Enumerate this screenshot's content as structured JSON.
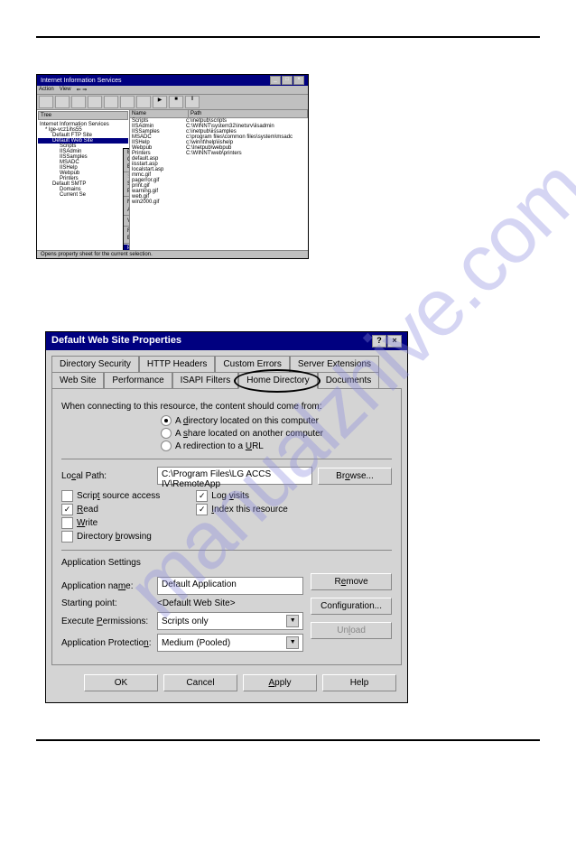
{
  "watermark": "manualzhive.com",
  "iis": {
    "title": "Internet Information Services",
    "menu": [
      "Action",
      "View"
    ],
    "tree_header": "Tree",
    "tree": [
      {
        "label": "Internet Information Services",
        "indent": 0
      },
      {
        "label": "* lge-vcz1ihs55",
        "indent": 1
      },
      {
        "label": "Default FTP Site",
        "indent": 2
      },
      {
        "label": "Default Web Site",
        "indent": 2,
        "sel": true
      },
      {
        "label": "Scripts",
        "indent": 3
      },
      {
        "label": "IISAdmin",
        "indent": 3
      },
      {
        "label": "IISSamples",
        "indent": 3
      },
      {
        "label": "MSADC",
        "indent": 3
      },
      {
        "label": "IISHelp",
        "indent": 3
      },
      {
        "label": "Webpub",
        "indent": 3
      },
      {
        "label": "Printers",
        "indent": 3
      },
      {
        "label": "Default SMTP",
        "indent": 2
      },
      {
        "label": "Domains",
        "indent": 3
      },
      {
        "label": "Current Se",
        "indent": 3
      }
    ],
    "list_headers": [
      "Name",
      "Path"
    ],
    "list": [
      {
        "name": "Scripts",
        "path": "c:\\inetpub\\scripts"
      },
      {
        "name": "IISAdmin",
        "path": "C:\\WINNT\\system32\\inetsrv\\iisadmin"
      },
      {
        "name": "IISSamples",
        "path": "c:\\inetpub\\iissamples"
      },
      {
        "name": "MSADC",
        "path": "c:\\program files\\common files\\system\\msadc"
      },
      {
        "name": "IISHelp",
        "path": "c:\\winnt\\help\\iishelp"
      },
      {
        "name": "Webpub",
        "path": "C:\\Inetpub\\webpub"
      },
      {
        "name": "Printers",
        "path": "C:\\WINNT\\web\\printers"
      },
      {
        "name": "default.asp",
        "path": ""
      },
      {
        "name": "iisstart.asp",
        "path": ""
      },
      {
        "name": "localstart.asp",
        "path": ""
      },
      {
        "name": "mmc.gif",
        "path": ""
      },
      {
        "name": "pagerror.gif",
        "path": ""
      },
      {
        "name": "print.gif",
        "path": ""
      },
      {
        "name": "warning.gif",
        "path": ""
      },
      {
        "name": "web.gif",
        "path": ""
      },
      {
        "name": "win2000.gif",
        "path": ""
      }
    ],
    "context_menu": [
      {
        "label": "Explore"
      },
      {
        "label": "Open"
      },
      {
        "label": "Browse"
      },
      {
        "sep": true
      },
      {
        "label": "Start",
        "disabled": true
      },
      {
        "label": "Stop"
      },
      {
        "label": "Pause"
      },
      {
        "sep": true
      },
      {
        "label": "New",
        "arrow": true
      },
      {
        "label": "All Tasks",
        "arrow": true
      },
      {
        "sep": true
      },
      {
        "label": "View",
        "arrow": true
      },
      {
        "sep": true
      },
      {
        "label": "Refresh"
      },
      {
        "label": "Export List..."
      },
      {
        "sep": true
      },
      {
        "label": "Properties",
        "sel": true
      },
      {
        "sep": true
      },
      {
        "label": "Help"
      }
    ],
    "status": "Opens property sheet for the current selection."
  },
  "dialog": {
    "title": "Default Web Site Properties",
    "tabs_row1": [
      "Directory Security",
      "HTTP Headers",
      "Custom Errors",
      "Server Extensions"
    ],
    "tabs_row2": [
      "Web Site",
      "Performance",
      "ISAPI Filters",
      "Home Directory",
      "Documents"
    ],
    "active_tab": "Home Directory",
    "intro": "When connecting to this resource, the content should come from:",
    "radios": [
      {
        "label": "A directory located on this computer",
        "checked": true,
        "key": "d"
      },
      {
        "label": "A share located on another computer",
        "checked": false,
        "key": "s"
      },
      {
        "label": "A redirection to a URL",
        "checked": false,
        "key": "U"
      }
    ],
    "local_path_label": "Local Path:",
    "local_path_value": "C:\\Program Files\\LG ACCS IV\\RemoteApp",
    "browse_label": "Browse...",
    "checks_left": [
      {
        "label": "Script source access",
        "checked": false
      },
      {
        "label": "Read",
        "checked": true
      },
      {
        "label": "Write",
        "checked": false
      },
      {
        "label": "Directory browsing",
        "checked": false
      }
    ],
    "checks_right": [
      {
        "label": "Log visits",
        "checked": true
      },
      {
        "label": "Index this resource",
        "checked": true
      }
    ],
    "app_settings_label": "Application Settings",
    "app_name_label": "Application name:",
    "app_name_value": "Default Application",
    "remove_label": "Remove",
    "starting_point_label": "Starting point:",
    "starting_point_value": "<Default Web Site>",
    "config_label": "Configuration...",
    "exec_perm_label": "Execute Permissions:",
    "exec_perm_value": "Scripts only",
    "app_prot_label": "Application Protection:",
    "app_prot_value": "Medium (Pooled)",
    "unload_label": "Unload",
    "buttons": [
      "OK",
      "Cancel",
      "Apply",
      "Help"
    ]
  }
}
